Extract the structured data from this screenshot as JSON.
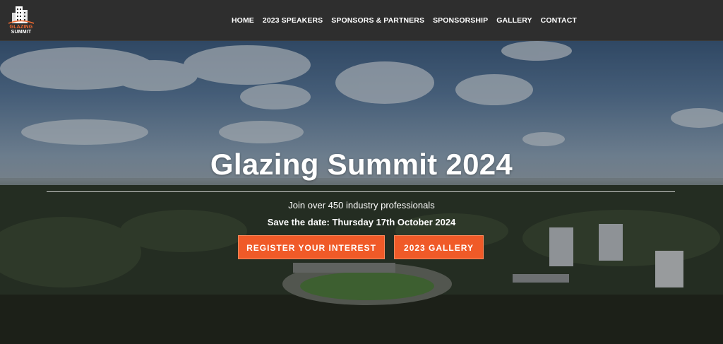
{
  "logo": {
    "line1": "GLAZING",
    "line2": "SUMMIT",
    "accent_color": "#f26a30"
  },
  "nav": {
    "items": [
      {
        "label": "HOME"
      },
      {
        "label": "2023 SPEAKERS"
      },
      {
        "label": "SPONSORS & PARTNERS"
      },
      {
        "label": "SPONSORSHIP"
      },
      {
        "label": "GALLERY"
      },
      {
        "label": "CONTACT"
      }
    ]
  },
  "hero": {
    "title": "Glazing Summit 2024",
    "subtitle": "Join over 450 industry professionals",
    "date_line": "Save the date: Thursday 17th October 2024",
    "buttons": {
      "register": "REGISTER YOUR INTEREST",
      "gallery": "2023 GALLERY"
    },
    "button_color": "#f05a28"
  }
}
